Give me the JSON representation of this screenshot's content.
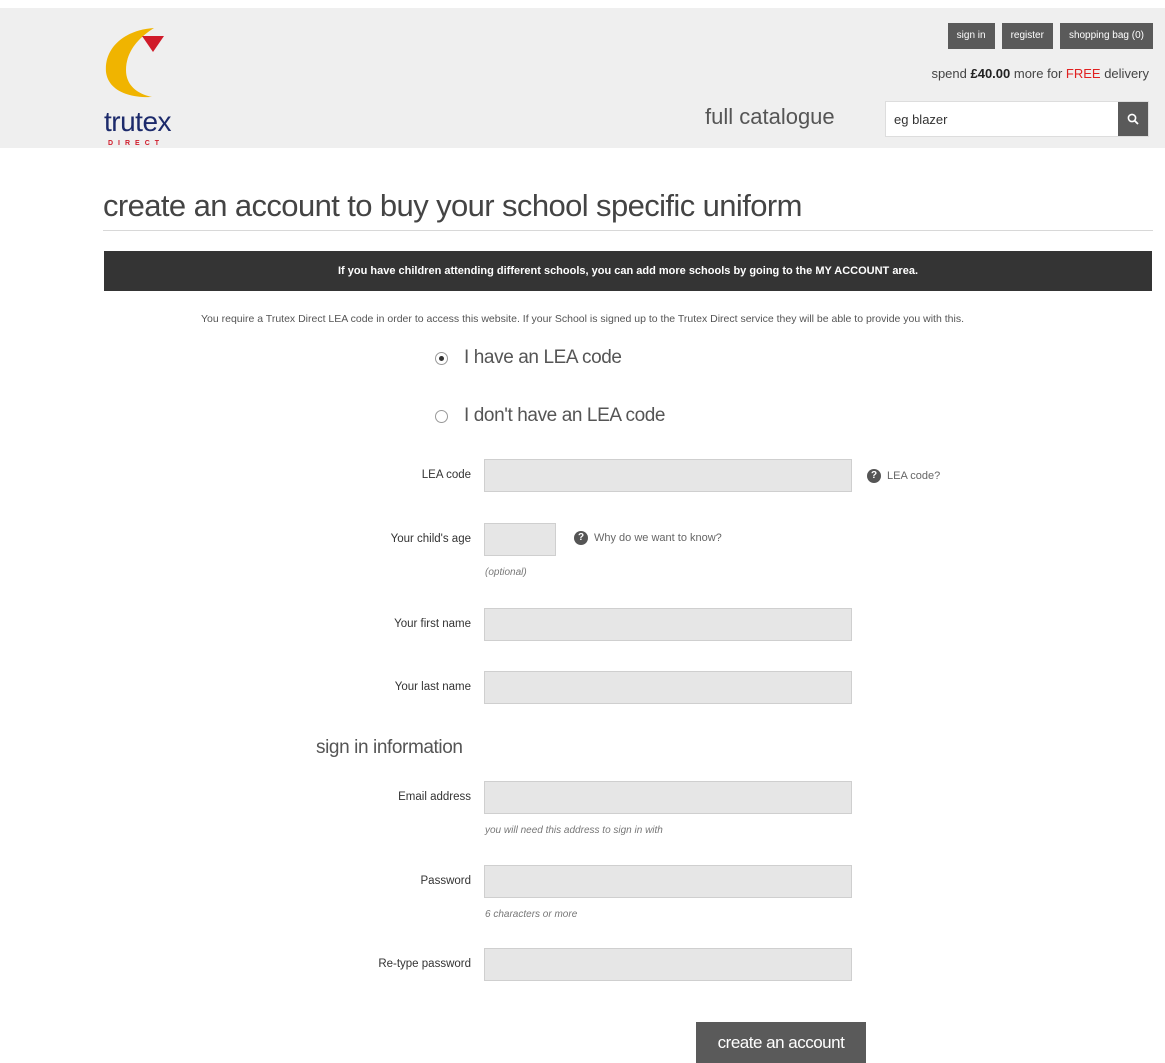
{
  "brand": {
    "name": "trutex",
    "sub": "DIRECT",
    "colors": {
      "yellow": "#f0b400",
      "red": "#d01b2a",
      "navy": "#1c2a6b"
    }
  },
  "header": {
    "buttons": {
      "sign_in": "sign in",
      "register": "register",
      "shopping_bag": "shopping bag (0)"
    },
    "delivery": {
      "prefix": "spend",
      "amount": "£40.00",
      "middle": "more for",
      "free": "FREE",
      "suffix": "delivery"
    },
    "catalogue_label": "full catalogue",
    "search": {
      "value": "eg blazer",
      "icon": "search-icon"
    }
  },
  "page": {
    "title": "create an account to buy your school specific uniform",
    "banner": "If you have children attending different schools, you can add more schools by going to the MY ACCOUNT area.",
    "notice": "You require a Trutex Direct LEA code in order to access this website. If your School is signed up to the Trutex Direct service they will be able to provide you with this."
  },
  "options": [
    {
      "label": "I have an LEA code",
      "checked": true
    },
    {
      "label": "I don't have an LEA code",
      "checked": false
    }
  ],
  "form": {
    "lea_code": {
      "label": "LEA code",
      "value": "",
      "help": "LEA code?"
    },
    "child_age": {
      "label": "Your child's age",
      "value": "",
      "help": "Why do we want to know?",
      "hint": "(optional)"
    },
    "first_name": {
      "label": "Your first name",
      "value": ""
    },
    "last_name": {
      "label": "Your last name",
      "value": ""
    },
    "section_title": "sign in information",
    "email": {
      "label": "Email address",
      "value": "",
      "hint": "you will need this address to sign in with"
    },
    "password": {
      "label": "Password",
      "value": "",
      "hint": "6 characters or more"
    },
    "retype_password": {
      "label": "Re-type password",
      "value": ""
    },
    "submit": "create an account"
  },
  "icons": {
    "help": "question-icon",
    "search": "search-icon"
  }
}
